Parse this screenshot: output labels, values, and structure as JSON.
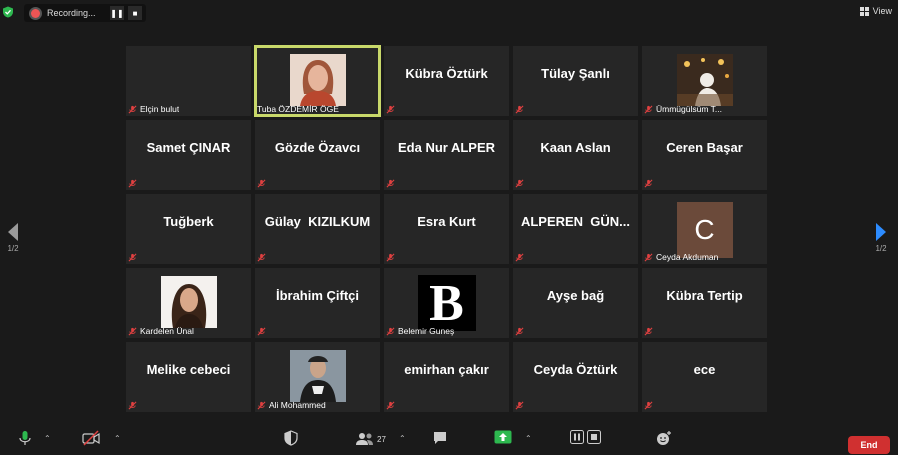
{
  "topbar": {
    "recording_label": "Recording...",
    "view_label": "View"
  },
  "participants": [
    {
      "name": "Elçin bulut",
      "display": "label"
    },
    {
      "name": "Tuba ÖZDEMİR ÖGE",
      "display": "photo",
      "active": true
    },
    {
      "name": "Kübra Öztürk",
      "display": "name"
    },
    {
      "name": "Tülay Şanlı",
      "display": "name"
    },
    {
      "name": "Ümmügülsüm T...",
      "display": "photo"
    },
    {
      "name": "Samet ÇINAR",
      "display": "name"
    },
    {
      "name": "Gözde Özavcı",
      "display": "name"
    },
    {
      "name": "Eda Nur ALPER",
      "display": "name"
    },
    {
      "name": "Kaan Aslan",
      "display": "name"
    },
    {
      "name": "Ceren Başar",
      "display": "name"
    },
    {
      "name": "Tuğberk",
      "display": "name"
    },
    {
      "name": "Gülay  KIZILKUM",
      "display": "name"
    },
    {
      "name": "Esra Kurt",
      "display": "name"
    },
    {
      "name": "ALPEREN  GÜN...",
      "display": "name"
    },
    {
      "name": "Ceyda Akduman",
      "display": "letter",
      "letter": "C"
    },
    {
      "name": "Kardelen Ünal",
      "display": "photo"
    },
    {
      "name": "İbrahim Çiftçi",
      "display": "name"
    },
    {
      "name": "Belemir Guneş",
      "display": "logo",
      "letter": "B"
    },
    {
      "name": "Ayşe bağ",
      "display": "name"
    },
    {
      "name": "Kübra Tertip",
      "display": "name"
    },
    {
      "name": "Melike cebeci",
      "display": "name"
    },
    {
      "name": "Ali Mohammed",
      "display": "photo"
    },
    {
      "name": "emirhan çakır",
      "display": "name"
    },
    {
      "name": "Ceyda Öztürk",
      "display": "name"
    },
    {
      "name": "ece",
      "display": "name"
    }
  ],
  "pagination": {
    "left": "1/2",
    "right": "1/2"
  },
  "toolbar": {
    "participants_count": "27",
    "end_label": "End"
  },
  "colors": {
    "active_outline": "#c8d86a",
    "end_button": "#d03030",
    "share_screen": "#2db84f",
    "nav_arrow": "#2d8cff",
    "mute_icon": "#e04040"
  }
}
